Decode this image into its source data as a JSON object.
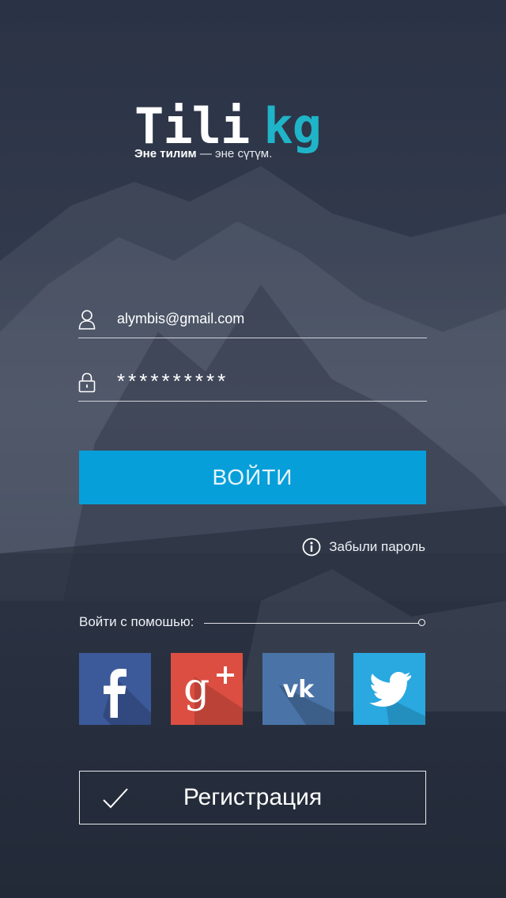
{
  "logo": {
    "word_main": "Tili",
    "word_accent": "kg",
    "tagline_bold": "Эне тилим",
    "tagline_rest": " — эне сүтүм."
  },
  "login": {
    "email_value": "alymbis@gmail.com",
    "password_mask": "**********",
    "submit_label": "ВОЙТИ",
    "forgot_label": "Забыли пароль"
  },
  "social": {
    "label": "Войти с помошью:",
    "buttons": [
      {
        "name": "facebook",
        "glyph": "f",
        "color": "#3c5a9a"
      },
      {
        "name": "google-plus",
        "glyph": "g+",
        "color": "#dc4e41"
      },
      {
        "name": "vk",
        "glyph": "vk",
        "color": "#4a74a8"
      },
      {
        "name": "twitter",
        "glyph": "bird",
        "color": "#2aa8e0"
      }
    ]
  },
  "register": {
    "label": "Регистрация"
  },
  "colors": {
    "accent": "#1fb4c8",
    "primary_button": "#079fd9"
  }
}
